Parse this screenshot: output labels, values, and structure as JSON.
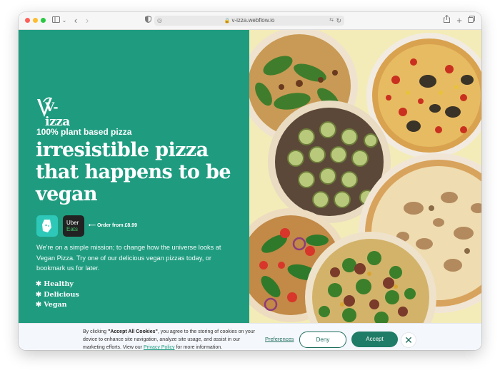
{
  "browser": {
    "url": "v-izza.webflow.io"
  },
  "brand": {
    "logo_text": "V-izza"
  },
  "hero": {
    "tagline": "100% plant based pizza",
    "headline": "irresistible pizza that happens to be vegan",
    "order_note": "Order from £8.99",
    "delivery_apps": {
      "deliveroo_label": "Deliveroo",
      "ubereats_line1": "Uber",
      "ubereats_line2": "Eats"
    },
    "mission": "We're on a simple mission; to change how the universe looks at Vegan Pizza. Try one of our delicious vegan pizzas today, or bookmark us for later.",
    "features": [
      "Healthy",
      "Delicious",
      "Vegan"
    ]
  },
  "cookie_banner": {
    "text_prefix": "By clicking ",
    "text_bold": "\"Accept All Cookies\"",
    "text_middle": ", you agree to the storing of cookies on your device to enhance site navigation, analyze site usage, and assist in our marketing efforts. View our ",
    "privacy_link": "Privacy Policy",
    "text_suffix": " for more information.",
    "preferences_label": "Preferences",
    "deny_label": "Deny",
    "accept_label": "Accept"
  },
  "colors": {
    "brand_green": "#1f9c80",
    "accent_dark_green": "#1f7c66",
    "image_background": "#f3ecb8"
  }
}
